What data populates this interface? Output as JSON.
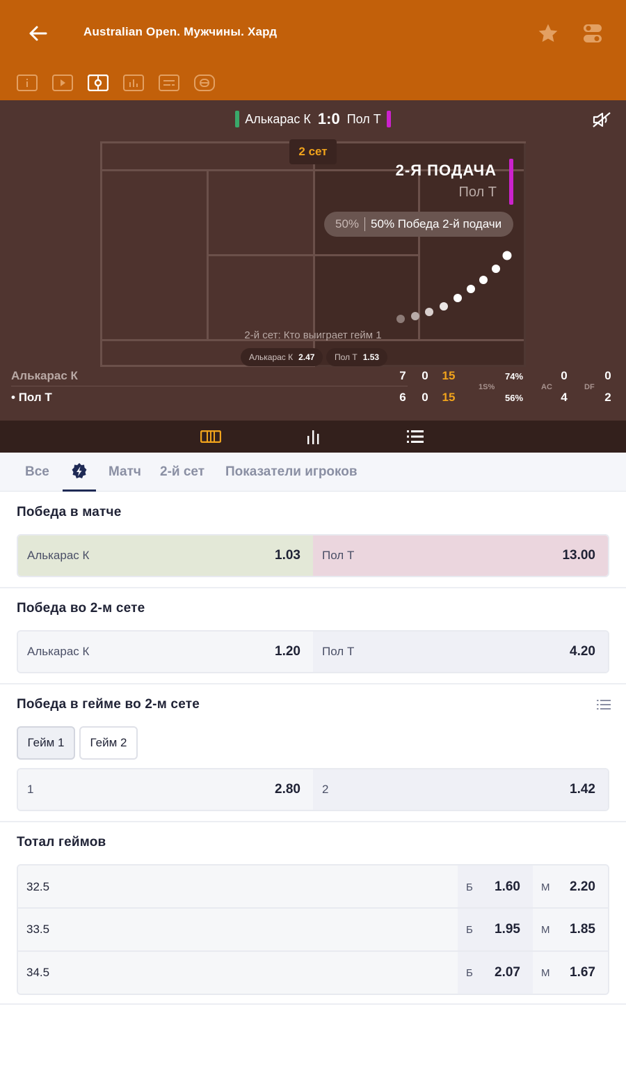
{
  "header": {
    "title": "Australian Open. Мужчины. Хард",
    "toolbar": [
      "info-icon",
      "video-icon",
      "scoreboard-icon",
      "stats-icon",
      "text-icon",
      "tracker-icon"
    ]
  },
  "match": {
    "player1": "Алькарас К",
    "player2": "Пол Т",
    "sets_score": "1:0",
    "set_label": "2 сет",
    "serve_title": "2-Я ПОДАЧА",
    "server": "Пол Т",
    "pct_left": "50%",
    "pct_right": "50% Победа 2-й подачи",
    "game_question": "2-й сет: Кто выиграет гейм 1",
    "chip1_name": "Алькарас К",
    "chip1_odd": "2.47",
    "chip2_name": "Пол Т",
    "chip2_odd": "1.53",
    "colors": {
      "player1": "#3aa86a",
      "player2": "#cc22cc",
      "accent": "#f0a31c",
      "header": "#c2600a"
    }
  },
  "stats": {
    "p1": {
      "name": "Алькарас К",
      "s1": "7",
      "s2": "0",
      "pts": "15",
      "first_serve": "74%",
      "ace": "0",
      "df": "0"
    },
    "p2": {
      "name": "Пол Т",
      "serving_marker": "•",
      "s1": "6",
      "s2": "0",
      "pts": "15",
      "first_serve": "56%",
      "ace": "4",
      "df": "2"
    },
    "labels": {
      "first_serve": "1S%",
      "ace": "AC",
      "df": "DF"
    }
  },
  "tabs": [
    "Все",
    "",
    "Матч",
    "2-й сет",
    "Показатели игроков"
  ],
  "markets": {
    "match_winner": {
      "title": "Победа в матче",
      "p1": "Алькарас К",
      "o1": "1.03",
      "p2": "Пол Т",
      "o2": "13.00"
    },
    "set2_winner": {
      "title": "Победа во 2-м сете",
      "p1": "Алькарас К",
      "o1": "1.20",
      "p2": "Пол Т",
      "o2": "4.20"
    },
    "game_winner": {
      "title": "Победа в гейме во 2-м сете",
      "games": [
        "Гейм 1",
        "Гейм 2"
      ],
      "p1": "1",
      "o1": "2.80",
      "p2": "2",
      "o2": "1.42"
    },
    "total_games": {
      "title": "Тотал геймов",
      "over_label": "Б",
      "under_label": "М",
      "rows": [
        {
          "line": "32.5",
          "over": "1.60",
          "under": "2.20"
        },
        {
          "line": "33.5",
          "over": "1.95",
          "under": "1.85"
        },
        {
          "line": "34.5",
          "over": "2.07",
          "under": "1.67"
        }
      ]
    }
  }
}
